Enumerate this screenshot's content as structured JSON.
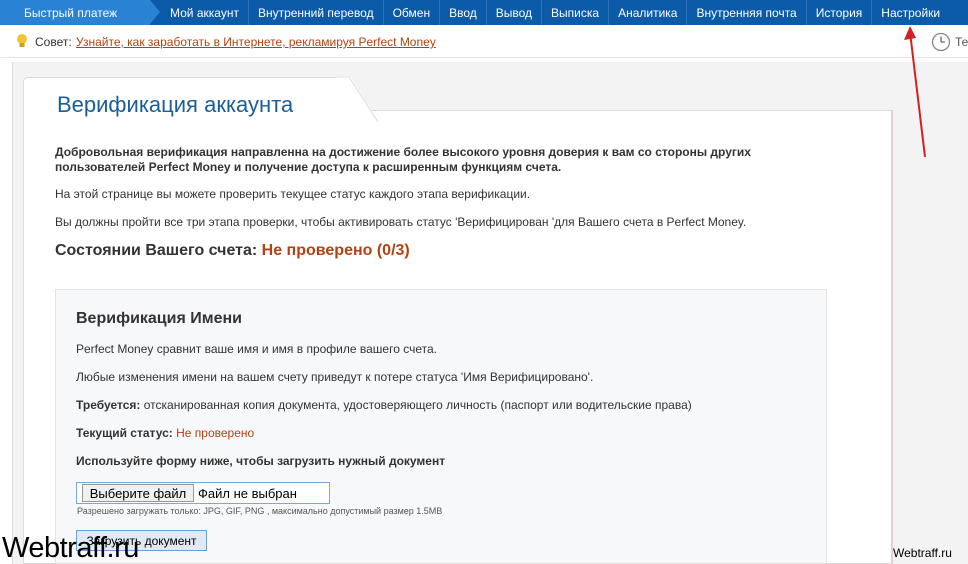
{
  "nav": {
    "quick_pay": "Быстрый платеж",
    "items": [
      "Мой аккаунт",
      "Внутренний перевод",
      "Обмен",
      "Ввод",
      "Вывод",
      "Выписка",
      "Аналитика",
      "Внутренняя почта",
      "История",
      "Настройки"
    ]
  },
  "tip": {
    "label": "Совет:",
    "link": "Узнайте, как заработать в Интернете, рекламируя Perfect Money",
    "clock_text": "Те"
  },
  "page": {
    "title": "Верификация аккаунта",
    "intro_bold": "Добровольная верификация направленна на достижение более высокого уровня доверия к вам со стороны других пользователей Perfect Money и получение доступа к расширенным функциям счета.",
    "p1": "На этой странице вы можете проверить текущее статус каждого этапа верификации.",
    "p2": "Вы должны пройти все три этапа проверки, чтобы активировать статус 'Верифицирован 'для Вашего счета в Perfect Money.",
    "status_label": "Состоянии Вашего счета:",
    "status_value": "Не проверено (0/3)"
  },
  "name_verification": {
    "title": "Верификация Имени",
    "line1": "Perfect Money сравнит ваше имя и имя в профиле вашего счета.",
    "line2": "Любые изменения имени на вашем счету приведут к потере статуса 'Имя Верифицировано'.",
    "required_label": "Требуется:",
    "required_text": "отсканированная копия документа, удостоверяющего личность (паспорт или водительские права)",
    "current_label": "Текущий статус:",
    "current_value": "Не проверено",
    "form_hint": "Используйте форму ниже, чтобы загрузить нужный документ",
    "choose_file": "Выберите файл",
    "no_file": "Файл не выбран",
    "allowed": "Разрешено загружать только: JPG, GIF, PNG , максимально допустимый размер 1.5MB",
    "upload": "Загрузить документ"
  },
  "watermark": {
    "left": "Webtraff.ru",
    "right": "Webtraff.ru"
  },
  "colors": {
    "nav_bg": "#0b5ba8",
    "quick_pay_bg": "#2a82d4",
    "accent_red": "#b04316",
    "title_blue": "#1d5d96"
  }
}
